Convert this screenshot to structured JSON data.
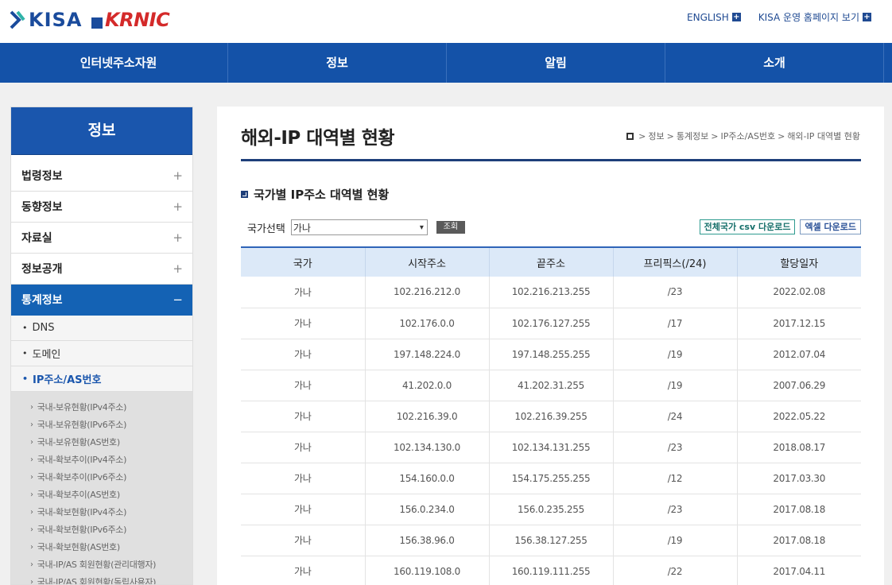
{
  "header": {
    "logo_kisa": "KISA",
    "logo_krnic": "KRNIC",
    "utils": [
      {
        "label": "ENGLISH"
      },
      {
        "label": "KISA 운영 홈페이지 보기"
      }
    ]
  },
  "gnb": [
    "인터넷주소자원",
    "정보",
    "알림",
    "소개"
  ],
  "lnb": {
    "title": "정보",
    "items": [
      {
        "label": "법령정보",
        "sign": "+"
      },
      {
        "label": "동향정보",
        "sign": "+"
      },
      {
        "label": "자료실",
        "sign": "+"
      },
      {
        "label": "정보공개",
        "sign": "+"
      },
      {
        "label": "통계정보",
        "sign": "−"
      }
    ],
    "sub": [
      {
        "label": "DNS"
      },
      {
        "label": "도메인"
      },
      {
        "label": "IP주소/AS번호"
      }
    ],
    "third": [
      "국내-보유현황(IPv4주소)",
      "국내-보유현황(IPv6주소)",
      "국내-보유현황(AS번호)",
      "국내-확보추이(IPv4주소)",
      "국내-확보추이(IPv6주소)",
      "국내-확보추이(AS번호)",
      "국내-확보현황(IPv4주소)",
      "국내-확보현황(IPv6주소)",
      "국내-확보현황(AS번호)",
      "국내-IP/AS 회원현황(관리대행자)",
      "국내-IP/AS 회원현황(독립사용자)"
    ]
  },
  "content": {
    "title": "해외-IP 대역별 현황",
    "breadcrumb": [
      "정보",
      "통계정보",
      "IP주소/AS번호",
      "해외-IP 대역별 현황"
    ],
    "section_title": "국가별 IP주소 대역별 현황",
    "filter_label": "국가선택",
    "selected_country": "가나",
    "search_button": "조회",
    "download_csv": "전체국가 csv 다운로드",
    "download_excel": "엑셀 다운로드",
    "table": {
      "headers": [
        "국가",
        "시작주소",
        "끝주소",
        "프리픽스(/24)",
        "할당일자"
      ],
      "rows": [
        [
          "가나",
          "102.216.212.0",
          "102.216.213.255",
          "/23",
          "2022.02.08"
        ],
        [
          "가나",
          "102.176.0.0",
          "102.176.127.255",
          "/17",
          "2017.12.15"
        ],
        [
          "가나",
          "197.148.224.0",
          "197.148.255.255",
          "/19",
          "2012.07.04"
        ],
        [
          "가나",
          "41.202.0.0",
          "41.202.31.255",
          "/19",
          "2007.06.29"
        ],
        [
          "가나",
          "102.216.39.0",
          "102.216.39.255",
          "/24",
          "2022.05.22"
        ],
        [
          "가나",
          "102.134.130.0",
          "102.134.131.255",
          "/23",
          "2018.08.17"
        ],
        [
          "가나",
          "154.160.0.0",
          "154.175.255.255",
          "/12",
          "2017.03.30"
        ],
        [
          "가나",
          "156.0.234.0",
          "156.0.235.255",
          "/23",
          "2017.08.18"
        ],
        [
          "가나",
          "156.38.96.0",
          "156.38.127.255",
          "/19",
          "2017.08.18"
        ],
        [
          "가나",
          "160.119.108.0",
          "160.119.111.255",
          "/22",
          "2017.04.11"
        ]
      ]
    }
  }
}
